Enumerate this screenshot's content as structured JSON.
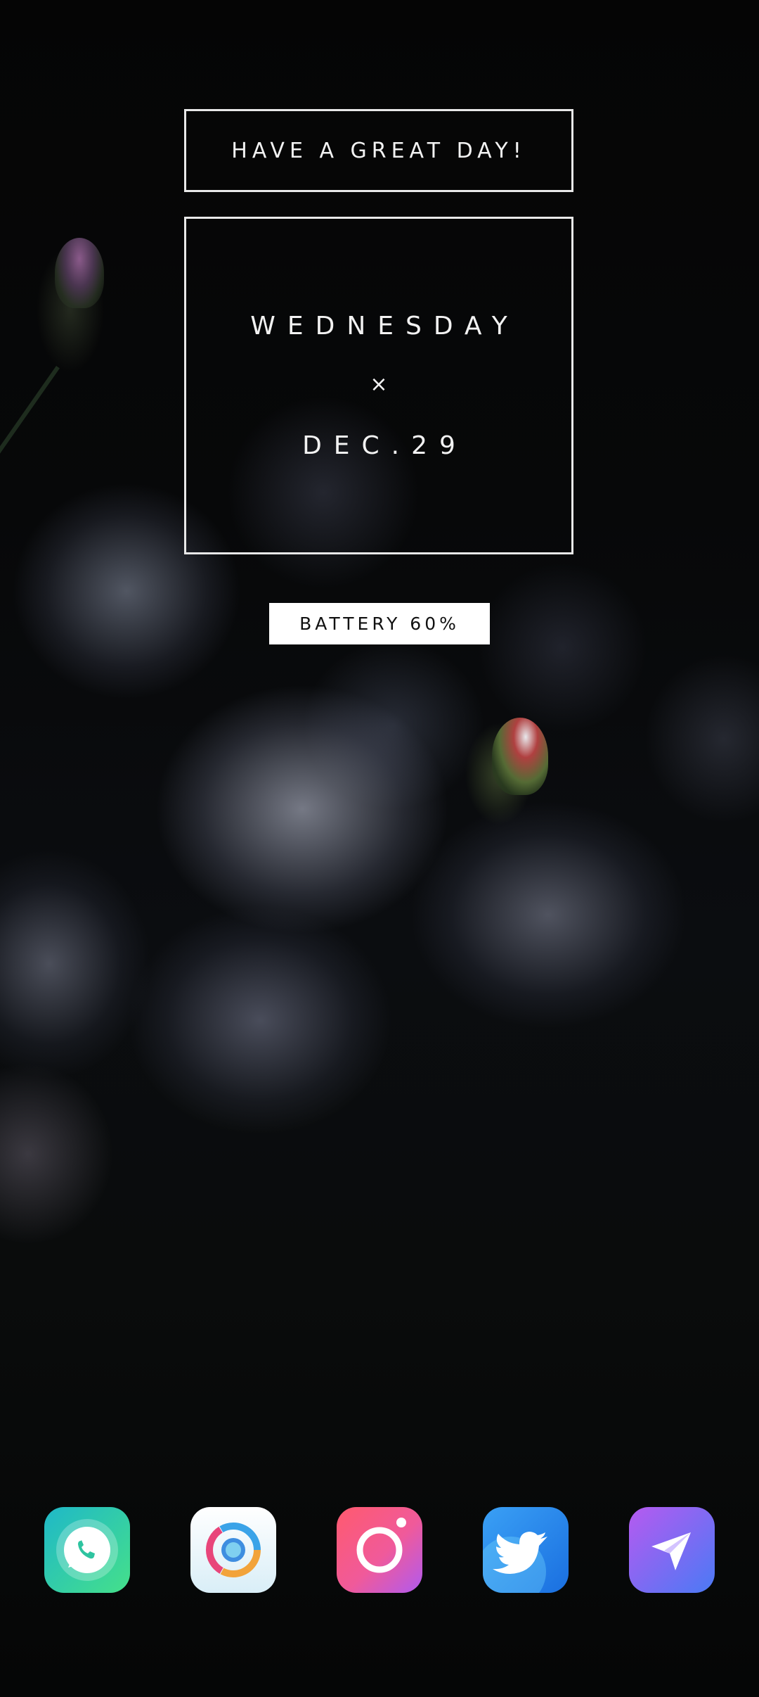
{
  "home": {
    "greeting": "HAVE A GREAT DAY!",
    "weekday": "WEDNESDAY",
    "separator": "×",
    "date": "DEC.29",
    "battery": "BATTERY 60%"
  },
  "dock": {
    "apps": [
      {
        "icon": "phone-icon",
        "color": "#2ec4a0"
      },
      {
        "icon": "browser-icon",
        "color": "#f5f7fa"
      },
      {
        "icon": "camera-icon",
        "color": "#f0567a"
      },
      {
        "icon": "bird-icon",
        "color": "#1d8cf0"
      },
      {
        "icon": "paper-plane-icon",
        "color": "#8a63f0"
      }
    ]
  }
}
